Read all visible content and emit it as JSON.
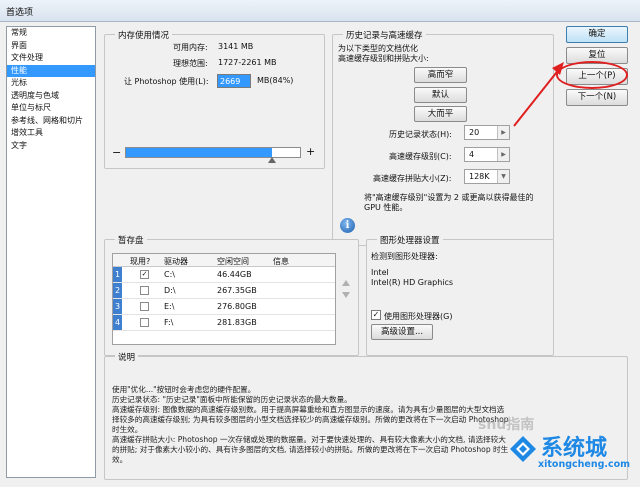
{
  "window": {
    "title": "首选项"
  },
  "categories": [
    {
      "label": "常规"
    },
    {
      "label": "界面"
    },
    {
      "label": "文件处理"
    },
    {
      "label": "性能",
      "selected": true
    },
    {
      "label": "光标"
    },
    {
      "label": "透明度与色域"
    },
    {
      "label": "单位与标尺"
    },
    {
      "label": "参考线、网格和切片"
    },
    {
      "label": "增效工具"
    },
    {
      "label": "文字"
    }
  ],
  "memory": {
    "legend": "内存使用情况",
    "available_label": "可用内存:",
    "available_value": "3141 MB",
    "ideal_label": "理想范围:",
    "ideal_value": "1727-2261 MB",
    "let_label": "让 Photoshop 使用(L):",
    "let_value": "2669",
    "let_suffix": "MB(84%)",
    "minus": "−",
    "plus": "+",
    "slider_fraction": 0.84
  },
  "history": {
    "legend": "历史记录与高速缓存",
    "note_line1": "为以下类型的文档优化",
    "note_line2": "高速缓存级别和拼贴大小:",
    "btn_tall": "高而窄",
    "btn_default": "默认",
    "btn_big": "大而平",
    "states_label": "历史记录状态(H):",
    "states_value": "20",
    "cache_label": "高速缓存级别(C):",
    "cache_value": "4",
    "tile_label": "高速缓存拼贴大小(Z):",
    "tile_value": "128K",
    "info_line1": "将\"高速缓存级别\"设置为 2 或更高以获得最佳的",
    "info_line2": "GPU 性能。"
  },
  "scratch": {
    "legend": "暂存盘",
    "headers": {
      "active": "现用?",
      "drive": "驱动器",
      "free": "空闲空间",
      "info": "信息"
    },
    "rows": [
      {
        "num": "1",
        "checked": "✓",
        "drive": "C:\\",
        "free": "46.44GB",
        "info": ""
      },
      {
        "num": "2",
        "checked": "",
        "drive": "D:\\",
        "free": "267.35GB",
        "info": ""
      },
      {
        "num": "3",
        "checked": "",
        "drive": "E:\\",
        "free": "276.80GB",
        "info": ""
      },
      {
        "num": "4",
        "checked": "",
        "drive": "F:\\",
        "free": "281.83GB",
        "info": ""
      }
    ]
  },
  "gpu": {
    "legend": "图形处理器设置",
    "detected_label": "检测到图形处理器:",
    "vendor": "Intel",
    "model": "Intel(R) HD Graphics",
    "use_label": "使用图形处理器(G)",
    "use_checked": "✓",
    "advanced_button": "高级设置..."
  },
  "buttons": {
    "ok": "确定",
    "reset": "复位",
    "prev": "上一个(P)",
    "next": "下一个(N)"
  },
  "description": {
    "legend": "说明",
    "lines": [
      "使用\"优化...\"按钮时会考虑您的硬件配置。",
      "历史记录状态: \"历史记录\"面板中所能保留的历史记录状态的最大数量。",
      "高速缓存级别: 图像数据的高速缓存级别数。用于提高屏幕重绘和直方图显示的速度。请为具有少量图层的大型文档选",
      "择较多的高速缓存级别; 为具有较多图层的小型文档选择较少的高速缓存级别。所做的更改将在下一次启动 Photoshop",
      "时生效。",
      "高速缓存拼贴大小: Photoshop 一次存储或处理的数据量。对于要快速处理的、具有较大像素大小的文档, 请选择较大",
      "的拼贴; 对于像素大小较小的、具有许多图层的文档, 请选择较小的拼贴。所做的更改将在下一次启动 Photoshop 时生",
      "效。"
    ]
  },
  "watermark": {
    "site_cn": "系统城",
    "site_url": "xitongcheng.com",
    "overlay": "shu指南"
  },
  "colors": {
    "selection": "#3399ff",
    "annotation": "#e02020",
    "watermark_blue": "#1e88e5"
  }
}
